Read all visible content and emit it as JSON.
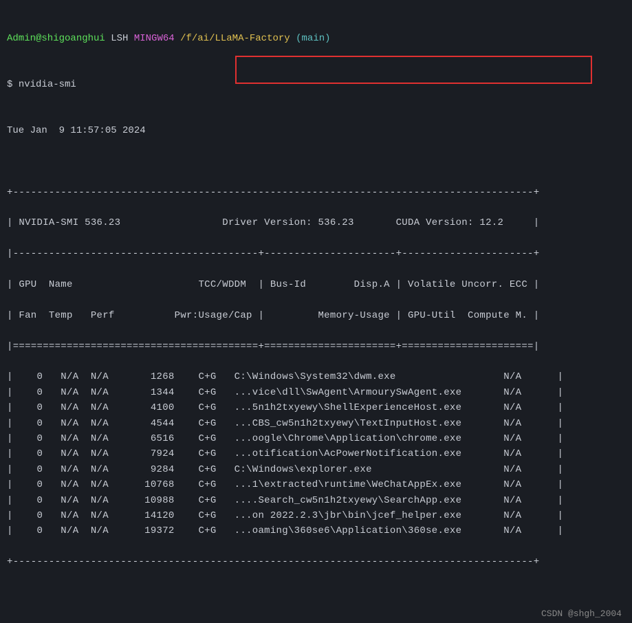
{
  "prompt": {
    "user": "Admin@shigoanghui",
    "host_part": " LSH ",
    "shell": "MINGW64",
    "path": "/f/ai/LLaMA-Factory",
    "branch": "(main)",
    "symbol": "$",
    "command": "nvidia-smi"
  },
  "timestamp": "Tue Jan  9 11:57:05 2024",
  "smi": {
    "top_border": "+---------------------------------------------------------------------------------------+",
    "header_line": "| NVIDIA-SMI 536.23                 Driver Version: 536.23       CUDA Version: 12.2     |",
    "divider1": "|-----------------------------------------+----------------------+----------------------+",
    "col_header1": "| GPU  Name                     TCC/WDDM  | Bus-Id        Disp.A | Volatile Uncorr. ECC |",
    "col_header2": "| Fan  Temp   Perf          Pwr:Usage/Cap |         Memory-Usage | GPU-Util  Compute M. |",
    "divider2": "|=========================================+======================+======================|"
  },
  "processes": [
    {
      "gpu": "0",
      "fan": "N/A",
      "temp": "N/A",
      "pid": "1268",
      "type": "C+G",
      "name": "C:\\Windows\\System32\\dwm.exe",
      "mem": "N/A"
    },
    {
      "gpu": "0",
      "fan": "N/A",
      "temp": "N/A",
      "pid": "1344",
      "type": "C+G",
      "name": "...vice\\dll\\SwAgent\\ArmourySwAgent.exe",
      "mem": "N/A"
    },
    {
      "gpu": "0",
      "fan": "N/A",
      "temp": "N/A",
      "pid": "4100",
      "type": "C+G",
      "name": "...5n1h2txyewy\\ShellExperienceHost.exe",
      "mem": "N/A"
    },
    {
      "gpu": "0",
      "fan": "N/A",
      "temp": "N/A",
      "pid": "4544",
      "type": "C+G",
      "name": "...CBS_cw5n1h2txyewy\\TextInputHost.exe",
      "mem": "N/A"
    },
    {
      "gpu": "0",
      "fan": "N/A",
      "temp": "N/A",
      "pid": "6516",
      "type": "C+G",
      "name": "...oogle\\Chrome\\Application\\chrome.exe",
      "mem": "N/A"
    },
    {
      "gpu": "0",
      "fan": "N/A",
      "temp": "N/A",
      "pid": "7924",
      "type": "C+G",
      "name": "...otification\\AcPowerNotification.exe",
      "mem": "N/A"
    },
    {
      "gpu": "0",
      "fan": "N/A",
      "temp": "N/A",
      "pid": "9284",
      "type": "C+G",
      "name": "C:\\Windows\\explorer.exe",
      "mem": "N/A"
    },
    {
      "gpu": "0",
      "fan": "N/A",
      "temp": "N/A",
      "pid": "10768",
      "type": "C+G",
      "name": "...1\\extracted\\runtime\\WeChatAppEx.exe",
      "mem": "N/A"
    },
    {
      "gpu": "0",
      "fan": "N/A",
      "temp": "N/A",
      "pid": "10988",
      "type": "C+G",
      "name": "....Search_cw5n1h2txyewy\\SearchApp.exe",
      "mem": "N/A"
    },
    {
      "gpu": "0",
      "fan": "N/A",
      "temp": "N/A",
      "pid": "14120",
      "type": "C+G",
      "name": "...on 2022.2.3\\jbr\\bin\\jcef_helper.exe",
      "mem": "N/A"
    },
    {
      "gpu": "0",
      "fan": "N/A",
      "temp": "N/A",
      "pid": "19372",
      "type": "C+G",
      "name": "...oaming\\360se6\\Application\\360se.exe",
      "mem": "N/A"
    }
  ],
  "bottom_border": "+---------------------------------------------------------------------------------------+",
  "watermark": "CSDN @shgh_2004"
}
